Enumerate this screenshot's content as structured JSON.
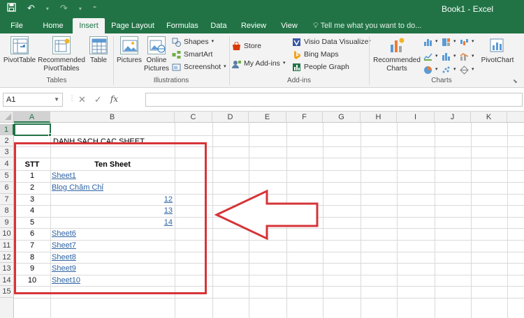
{
  "window": {
    "title": "Book1 - Excel"
  },
  "tabs": [
    {
      "label": "File"
    },
    {
      "label": "Home"
    },
    {
      "label": "Insert"
    },
    {
      "label": "Page Layout"
    },
    {
      "label": "Formulas"
    },
    {
      "label": "Data"
    },
    {
      "label": "Review"
    },
    {
      "label": "View"
    }
  ],
  "active_tab": "Insert",
  "tell_me": "Tell me what you want to do...",
  "ribbon": {
    "tables": {
      "label": "Tables",
      "pivottable": "PivotTable",
      "recommended_line1": "Recommended",
      "recommended_line2": "PivotTables",
      "table": "Table"
    },
    "illustrations": {
      "label": "Illustrations",
      "pictures": "Pictures",
      "online_line1": "Online",
      "online_line2": "Pictures",
      "shapes": "Shapes",
      "smartart": "SmartArt",
      "screenshot": "Screenshot"
    },
    "addins": {
      "label": "Add-ins",
      "store": "Store",
      "my_addins": "My Add-ins",
      "visio": "Visio Data Visualizer",
      "bing": "Bing Maps",
      "people": "People Graph"
    },
    "charts": {
      "label": "Charts",
      "recommended_line1": "Recommended",
      "recommended_line2": "Charts",
      "pivotchart": "PivotChart"
    }
  },
  "formula_bar": {
    "name_box": "A1",
    "fx": "fx",
    "value": ""
  },
  "columns": [
    "A",
    "B",
    "C",
    "D",
    "E",
    "F",
    "G",
    "H",
    "I",
    "J",
    "K"
  ],
  "rows": [
    "1",
    "2",
    "3",
    "4",
    "5",
    "6",
    "7",
    "8",
    "9",
    "10",
    "11",
    "12",
    "13",
    "14",
    "15"
  ],
  "sheet": {
    "title_cell": "DANH SACH CAC SHEET",
    "header_stt": "STT",
    "header_name": "Ten Sheet",
    "entries": [
      {
        "stt": "1",
        "name": "Sheet1",
        "align": "left"
      },
      {
        "stt": "2",
        "name": "Blog Chăm Chỉ",
        "align": "left"
      },
      {
        "stt": "3",
        "name": "12",
        "align": "right"
      },
      {
        "stt": "4",
        "name": "13",
        "align": "right"
      },
      {
        "stt": "5",
        "name": "14",
        "align": "right"
      },
      {
        "stt": "6",
        "name": "Sheet6",
        "align": "left"
      },
      {
        "stt": "7",
        "name": "Sheet7",
        "align": "left"
      },
      {
        "stt": "8",
        "name": "Sheet8",
        "align": "left"
      },
      {
        "stt": "9",
        "name": "Sheet9",
        "align": "left"
      },
      {
        "stt": "10",
        "name": "Sheet10",
        "align": "left"
      }
    ]
  },
  "colors": {
    "excel_green": "#217346",
    "annotation_red": "#d63438",
    "link_blue": "#2e64a3"
  }
}
